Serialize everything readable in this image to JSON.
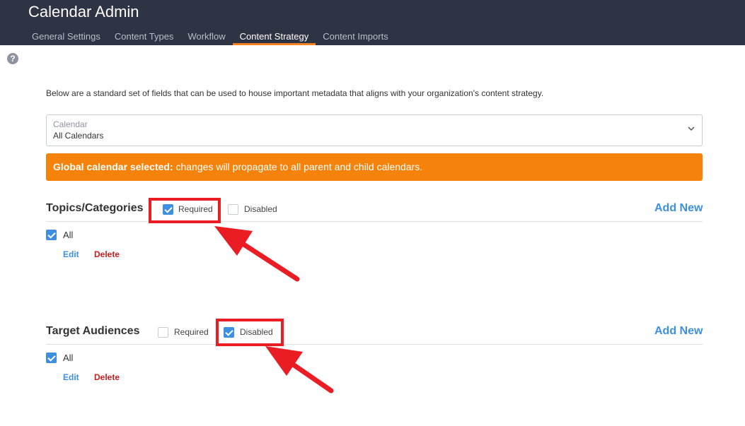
{
  "header": {
    "title": "Calendar Admin",
    "tabs": [
      {
        "label": "General Settings"
      },
      {
        "label": "Content Types"
      },
      {
        "label": "Workflow"
      },
      {
        "label": "Content Strategy"
      },
      {
        "label": "Content Imports"
      }
    ],
    "active_tab": "Content Strategy"
  },
  "help_icon": "question-circle-icon",
  "intro_text": "Below are a standard set of fields that can be used to house important metadata that aligns with your organization's content strategy.",
  "calendar_select": {
    "label": "Calendar",
    "value": "All Calendars"
  },
  "alert": {
    "bold": "Global calendar selected:",
    "text": " changes will propagate to all parent and child calendars.",
    "color": "#f5820a"
  },
  "sections": [
    {
      "title": "Topics/Categories",
      "required_label": "Required",
      "required_checked": true,
      "disabled_label": "Disabled",
      "disabled_checked": false,
      "add_new": "Add New",
      "items": [
        {
          "label": "All",
          "checked": true,
          "edit": "Edit",
          "delete": "Delete"
        }
      ]
    },
    {
      "title": "Target Audiences",
      "required_label": "Required",
      "required_checked": false,
      "disabled_label": "Disabled",
      "disabled_checked": true,
      "add_new": "Add New",
      "items": [
        {
          "label": "All",
          "checked": true,
          "edit": "Edit",
          "delete": "Delete"
        }
      ]
    }
  ],
  "colors": {
    "topbar": "#2f3444",
    "accent": "#3d8fe0",
    "active_tab_underline": "#f5821f",
    "delete": "#c81e1e",
    "annotation": "#ea1c24"
  }
}
